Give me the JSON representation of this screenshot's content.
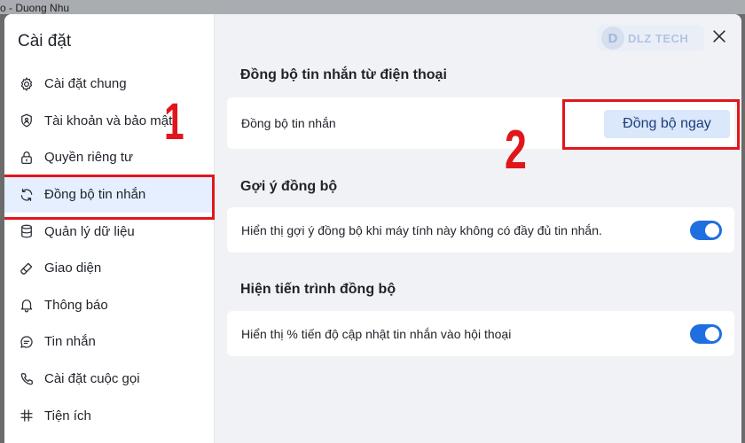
{
  "background": {
    "window_title_fragment": "o - Duong Nhu"
  },
  "sidebar": {
    "title": "Cài đặt",
    "items": [
      {
        "label": "Cài đặt chung",
        "icon": "gear-icon"
      },
      {
        "label": "Tài khoản và bảo mật",
        "icon": "shield-icon"
      },
      {
        "label": "Quyền riêng tư",
        "icon": "lock-icon"
      },
      {
        "label": "Đồng bộ tin nhắn",
        "icon": "sync-icon",
        "active": true
      },
      {
        "label": "Quản lý dữ liệu",
        "icon": "database-icon"
      },
      {
        "label": "Giao diện",
        "icon": "brush-icon"
      },
      {
        "label": "Thông báo",
        "icon": "bell-icon"
      },
      {
        "label": "Tin nhắn",
        "icon": "chat-icon"
      },
      {
        "label": "Cài đặt cuộc gọi",
        "icon": "phone-icon"
      },
      {
        "label": "Tiện ích",
        "icon": "grid-icon"
      }
    ]
  },
  "annotations": {
    "step1": "1",
    "step2": "2",
    "color": "#e1161c"
  },
  "watermark": {
    "mark": "D",
    "text": "DLZ TECH"
  },
  "main": {
    "sync_section": {
      "title": "Đồng bộ tin nhắn từ điện thoại",
      "row_label": "Đồng bộ tin nhắn",
      "button_label": "Đồng bộ ngay"
    },
    "suggest_section": {
      "title": "Gợi ý đồng bộ",
      "row_label": "Hiển thị gợi ý đồng bộ khi máy tính này không có đầy đủ tin nhắn.",
      "toggle_on": true
    },
    "progress_section": {
      "title": "Hiện tiến trình đồng bộ",
      "row_label": "Hiển thị % tiến độ cập nhật tin nhắn vào hội thoại",
      "toggle_on": true
    }
  },
  "colors": {
    "accent": "#1f6fe0",
    "active_bg": "#e5efff",
    "button_bg": "#dbe7fb"
  }
}
